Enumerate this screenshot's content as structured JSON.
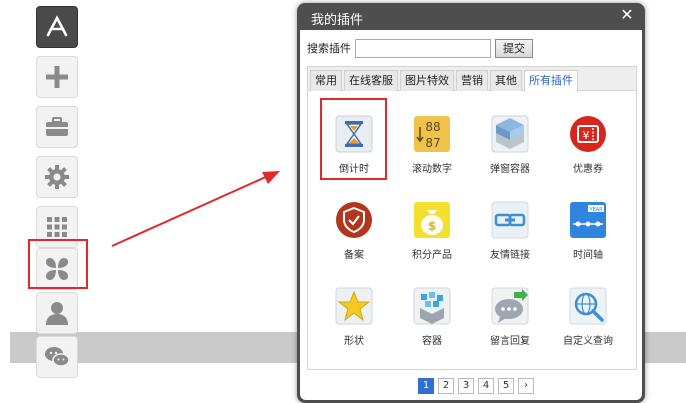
{
  "toolbar": {
    "items": [
      {
        "icon": "app-store-icon"
      },
      {
        "icon": "plus-icon"
      },
      {
        "icon": "toolbox-icon"
      },
      {
        "icon": "gear-icon"
      },
      {
        "icon": "grid-icon"
      },
      {
        "icon": "clover-icon"
      },
      {
        "icon": "person-icon"
      },
      {
        "icon": "wechat-icon"
      }
    ]
  },
  "dialog": {
    "title": "我的插件",
    "close": "✕",
    "search": {
      "label": "搜索插件",
      "value": "",
      "button": "提交"
    },
    "tabs": [
      "常用",
      "在线客服",
      "图片特效",
      "营销",
      "其他",
      "所有插件"
    ],
    "active_tab": "所有插件",
    "plugins": [
      {
        "label": "倒计时",
        "icon": "hourglass-icon"
      },
      {
        "label": "滚动数字",
        "icon": "rolling-number-icon",
        "digits_top": "88",
        "digits_bottom": "87"
      },
      {
        "label": "弹窗容器",
        "icon": "popup-layers-icon"
      },
      {
        "label": "优惠券",
        "icon": "coupon-icon",
        "symbol": "¥"
      },
      {
        "label": "备案",
        "icon": "shield-icon"
      },
      {
        "label": "积分产品",
        "icon": "money-bag-icon",
        "symbol": "$"
      },
      {
        "label": "友情链接",
        "icon": "link-icon"
      },
      {
        "label": "时间轴",
        "icon": "timeline-icon",
        "badge": "YEAR"
      },
      {
        "label": "形状",
        "icon": "star-icon"
      },
      {
        "label": "容器",
        "icon": "blocks-icon"
      },
      {
        "label": "留言回复",
        "icon": "chat-reply-icon"
      },
      {
        "label": "自定义查询",
        "icon": "search-globe-icon"
      }
    ],
    "pager": {
      "pages": [
        "1",
        "2",
        "3",
        "4",
        "5"
      ],
      "current": "1",
      "next": "›"
    }
  },
  "colors": {
    "highlight": "#e1282d",
    "active_tab_text": "#2c64c8",
    "pager_active": "#2e6fd1",
    "dialog_frame": "#4e4e4e"
  }
}
